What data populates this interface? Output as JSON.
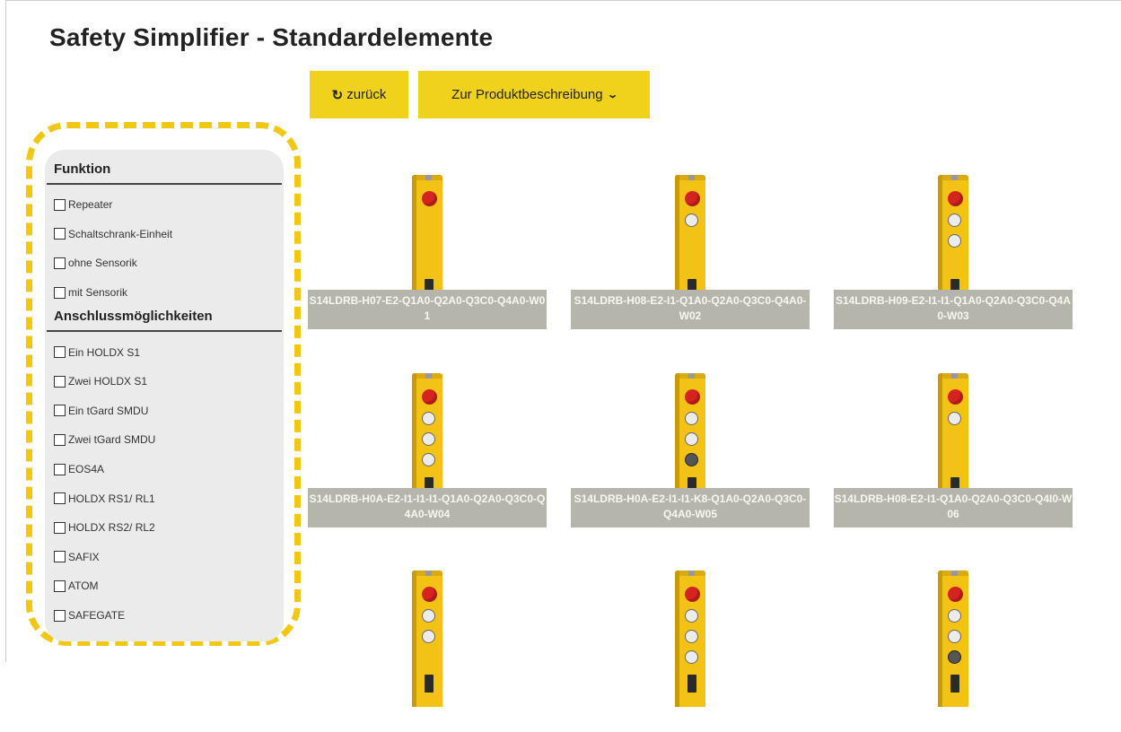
{
  "page": {
    "title": "Safety Simplifier - Standardelemente"
  },
  "toolbar": {
    "back_icon": "↻",
    "back_label": "zurück",
    "description_label": "Zur Produktbeschreibung",
    "description_icon": "chevron-down-icon",
    "accent_color": "#f0d21c"
  },
  "filters": {
    "highlight_color": "#f0c814",
    "sections": [
      {
        "heading": "Funktion",
        "options": [
          "Repeater",
          "Schaltschrank-Einheit",
          "ohne Sensorik",
          "mit Sensorik"
        ]
      },
      {
        "heading": "Anschlussmöglichkeiten",
        "options": [
          "Ein HOLDX S1",
          "Zwei HOLDX S1",
          "Ein tGard SMDU",
          "Zwei tGard SMDU",
          "EOS4A",
          "HOLDX RS1/ RL1",
          "HOLDX RS2/ RL2",
          "SAFIX",
          "ATOM",
          "SAFEGATE"
        ]
      }
    ]
  },
  "products": [
    {
      "name": "S14LDRB-H07-E2-Q1A0-Q2A0-Q3C0-Q4A0-W01",
      "controls": [
        "estop"
      ]
    },
    {
      "name": "S14LDRB-H08-E2-I1-Q1A0-Q2A0-Q3C0-Q4A0-W02",
      "controls": [
        "estop",
        "lamp"
      ]
    },
    {
      "name": "S14LDRB-H09-E2-I1-I1-Q1A0-Q2A0-Q3C0-Q4A0-W03",
      "controls": [
        "estop",
        "lamp",
        "lamp"
      ]
    },
    {
      "name": "S14LDRB-H0A-E2-I1-I1-I1-Q1A0-Q2A0-Q3C0-Q4A0-W04",
      "controls": [
        "estop",
        "lamp",
        "lamp",
        "lamp"
      ]
    },
    {
      "name": "S14LDRB-H0A-E2-I1-I1-K8-Q1A0-Q2A0-Q3C0-Q4A0-W05",
      "controls": [
        "estop",
        "lamp",
        "lamp",
        "key"
      ]
    },
    {
      "name": "S14LDRB-H08-E2-I1-Q1A0-Q2A0-Q3C0-Q4I0-W06",
      "controls": [
        "estop",
        "lamp"
      ]
    },
    {
      "name": "",
      "controls": [
        "estop",
        "lamp",
        "lamp"
      ]
    },
    {
      "name": "",
      "controls": [
        "estop",
        "lamp",
        "lamp",
        "lamp"
      ]
    },
    {
      "name": "",
      "controls": [
        "estop",
        "lamp",
        "lamp",
        "key"
      ]
    }
  ]
}
